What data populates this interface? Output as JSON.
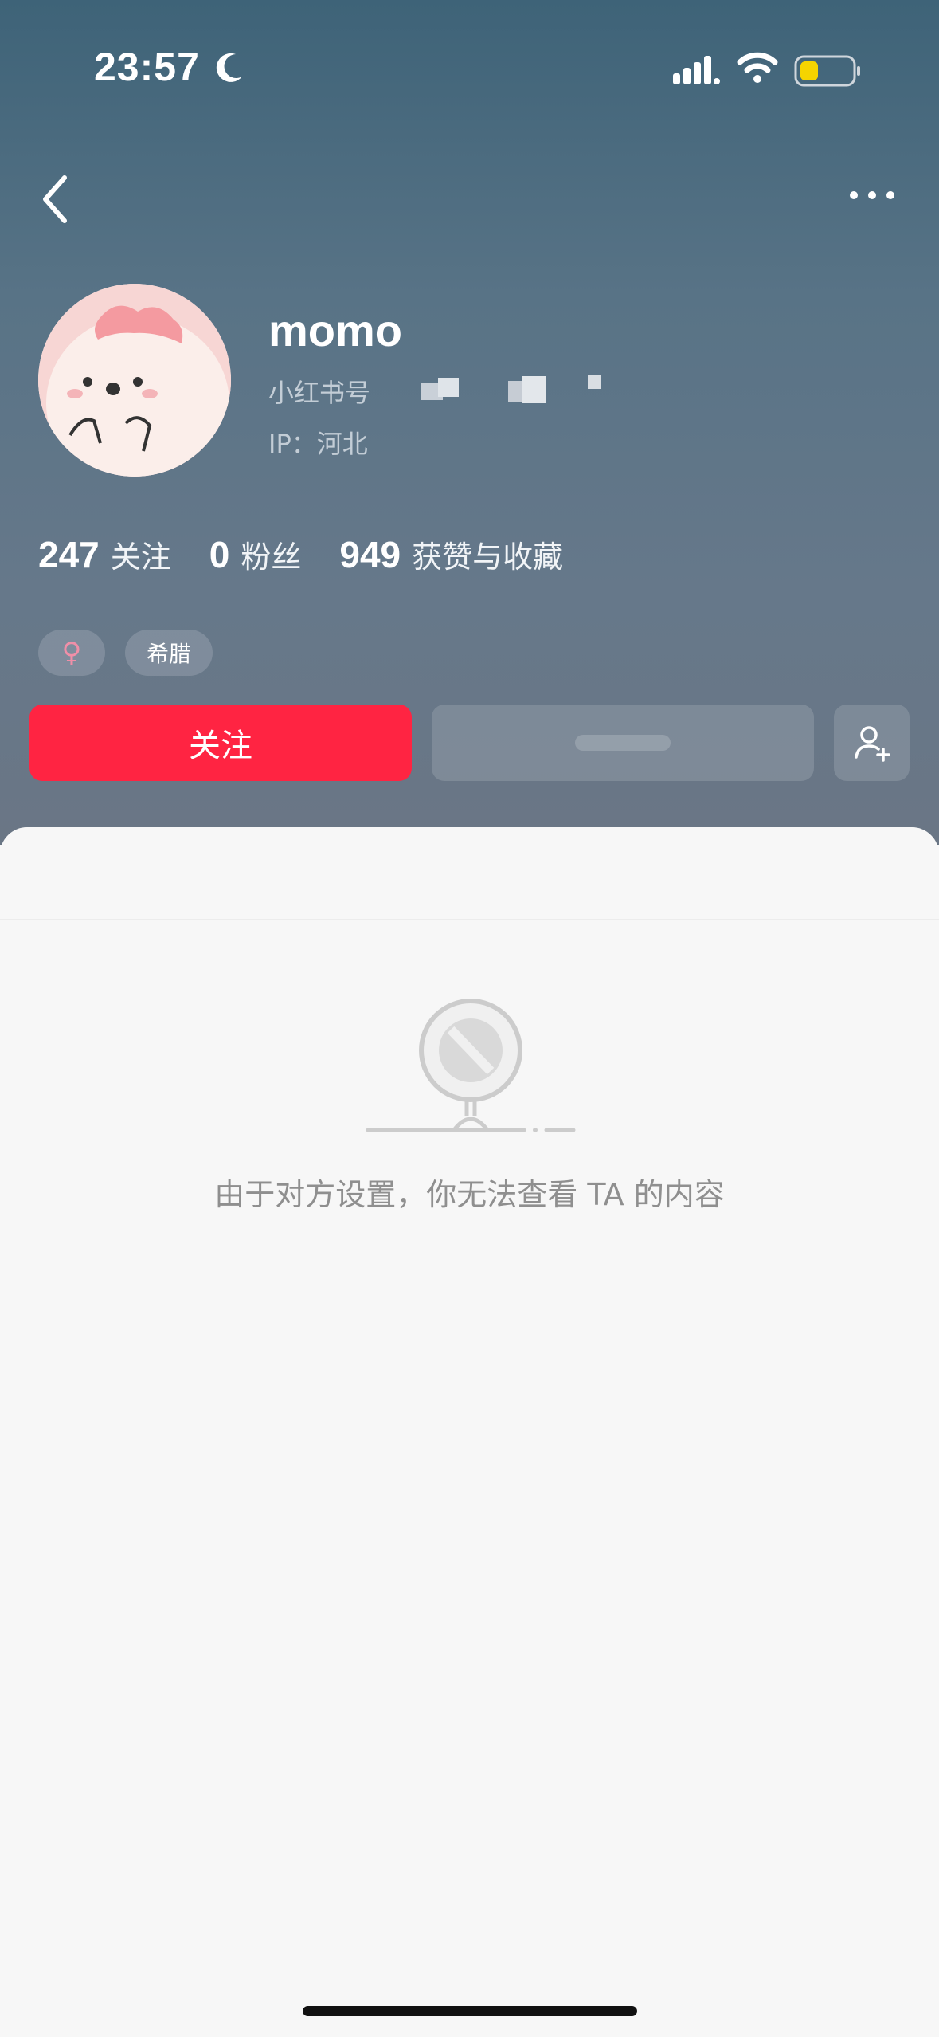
{
  "status_bar": {
    "time": "23:57",
    "icons": [
      "moon-icon",
      "signal-icon",
      "wifi-icon",
      "battery-icon"
    ],
    "battery_color": "#f5d400"
  },
  "nav": {
    "back_icon": "chevron-left-icon",
    "more_icon": "more-dots-icon"
  },
  "profile": {
    "username": "momo",
    "id_label": "小红书号",
    "ip_text": "IP：河北",
    "tags": {
      "gender": "♀",
      "region": "希腊"
    }
  },
  "stats": [
    {
      "value": "247",
      "label": "关注"
    },
    {
      "value": "0",
      "label": "粉丝"
    },
    {
      "value": "949",
      "label": "获赞与收藏"
    }
  ],
  "actions": {
    "follow_label": "关注",
    "accent": "#ff2442"
  },
  "empty_state": {
    "icon": "blocked-icon",
    "message": "由于对方设置，你无法查看 TA 的内容"
  }
}
